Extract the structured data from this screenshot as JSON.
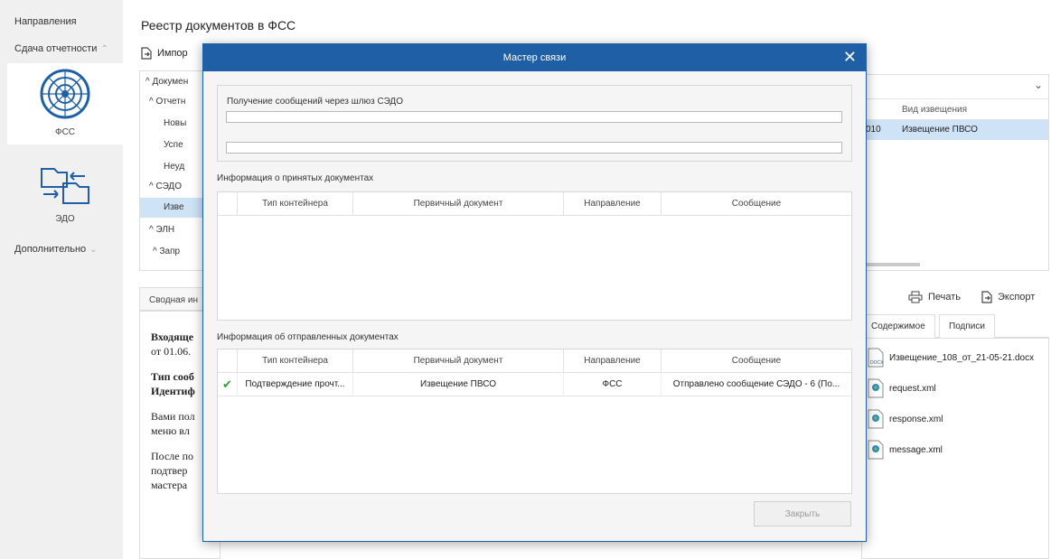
{
  "leftnav": {
    "directions": "Направления",
    "reporting": "Сдача отчетности",
    "fss_label": "ФСС",
    "edo_label": "ЭДО",
    "additional": "Дополнительно"
  },
  "main": {
    "title": "Реестр документов в ФСС",
    "import_label": "Импор",
    "tree": [
      "^ Докумен",
      "^ Отчетн",
      "Новы",
      "Успе",
      "Неуд",
      "^ СЭДО",
      "Изве",
      "^ ЭЛН",
      "^ Запр"
    ],
    "summary_tab": "Сводная ин",
    "summary_lines": [
      "Входяще",
      "от 01.06.",
      "Тип сооб",
      "Идентиф",
      "Вами пол",
      "меню вл",
      "После по",
      "подтвер",
      "мастера"
    ]
  },
  "right": {
    "header_col": "Вид извещения",
    "row_code": "010",
    "row_value": "Извещение ПВСО",
    "print": "Печать",
    "export": "Экспорт",
    "tab_contents": "Содержимое",
    "tab_signatures": "Подписи",
    "files": [
      "Извещение_108_от_21-05-21.docx",
      "request.xml",
      "response.xml",
      "message.xml"
    ]
  },
  "modal": {
    "title": "Мастер связи",
    "gateway_label": "Получение сообщений через шлюз СЭДО",
    "progress1": 0,
    "progress2": 0,
    "received_label": "Информация о принятых документах",
    "sent_label": "Информация об отправленных документах",
    "columns": [
      "Тип контейнера",
      "Первичный документ",
      "Направление",
      "Сообщение"
    ],
    "sent_rows": [
      {
        "type": "Подтверждение прочт...",
        "primary": "Извещение ПВСО",
        "direction": "ФСС",
        "message": "Отправлено сообщение СЭДО - 6 (По..."
      }
    ],
    "close_label": "Закрыть"
  },
  "colors": {
    "accent": "#1e5fa6",
    "selection": "#cfe3f7",
    "check": "#2e9e3a"
  }
}
